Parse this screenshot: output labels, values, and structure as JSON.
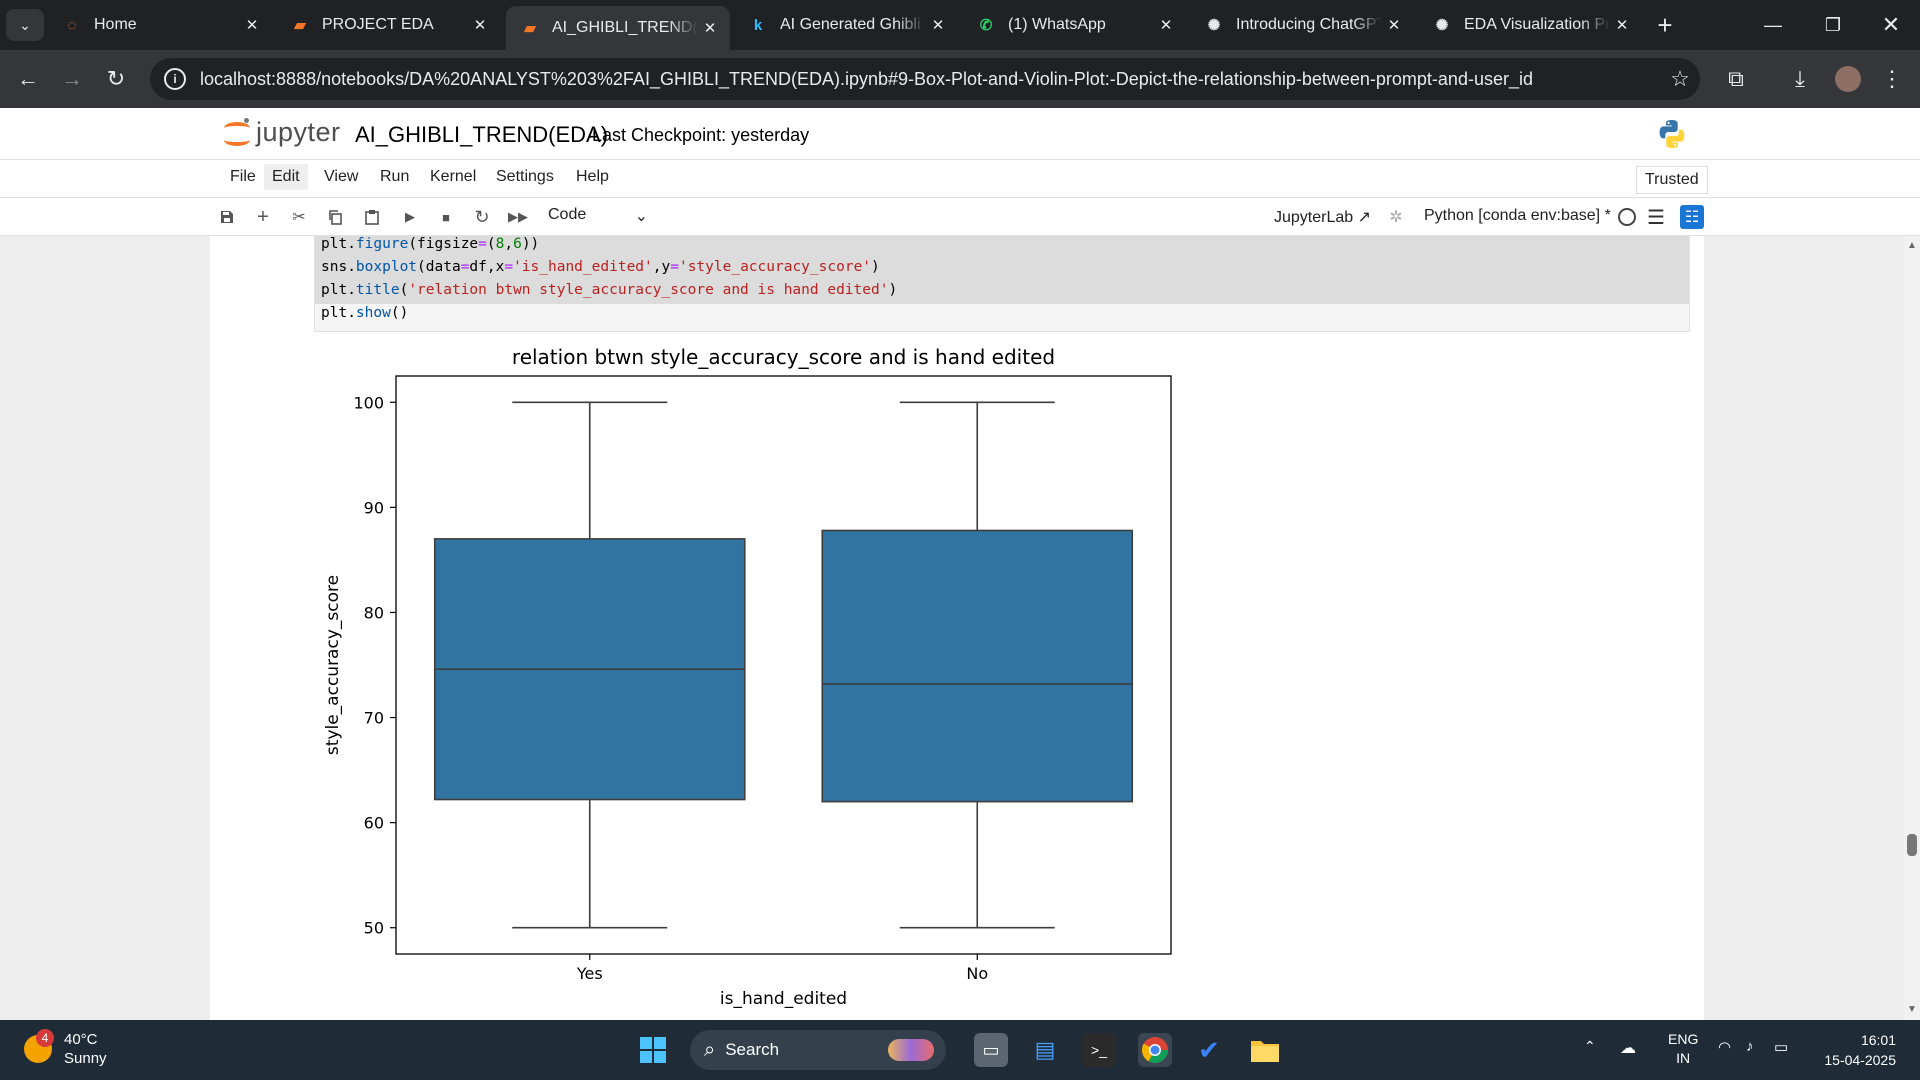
{
  "browser": {
    "tabs": [
      {
        "title": "Home",
        "icon": "jupyter-icon",
        "active": false
      },
      {
        "title": "PROJECT EDA",
        "icon": "notebook-icon",
        "active": false
      },
      {
        "title": "AI_GHIBLI_TREND(EDA",
        "icon": "notebook-icon",
        "active": true
      },
      {
        "title": "AI Generated Ghibli S",
        "icon": "kaggle-icon",
        "active": false
      },
      {
        "title": "(1) WhatsApp",
        "icon": "whatsapp-icon",
        "active": false
      },
      {
        "title": "Introducing ChatGPT",
        "icon": "openai-icon",
        "active": false
      },
      {
        "title": "EDA Visualization Pra",
        "icon": "openai-icon",
        "active": false
      }
    ],
    "url": "localhost:8888/notebooks/DA%20ANALYST%203%2FAI_GHIBLI_TREND(EDA).ipynb#9-Box-Plot-and-Violin-Plot:-Depict-the-relationship-between-prompt-and-user_id"
  },
  "jupyter": {
    "logo_text": "jupyter",
    "notebook_title": "AI_GHIBLI_TREND(EDA)",
    "checkpoint": "Last Checkpoint: yesterday",
    "menu": [
      "File",
      "Edit",
      "View",
      "Run",
      "Kernel",
      "Settings",
      "Help"
    ],
    "highlighted_menu": "Edit",
    "trusted_label": "Trusted",
    "cell_type": "Code",
    "jupyterlab_label": "JupyterLab",
    "kernel_label": "Python [conda env:base] *"
  },
  "code": [
    [
      {
        "t": "plt.",
        "c": "#000"
      },
      {
        "t": "figure",
        "c": "#0055aa"
      },
      {
        "t": "(figsize",
        "c": "#000"
      },
      {
        "t": "=",
        "c": "#aa22ff"
      },
      {
        "t": "(",
        "c": "#000"
      },
      {
        "t": "8",
        "c": "#008000"
      },
      {
        "t": ",",
        "c": "#000"
      },
      {
        "t": "6",
        "c": "#008000"
      },
      {
        "t": "))",
        "c": "#000"
      }
    ],
    [
      {
        "t": "sns.",
        "c": "#000"
      },
      {
        "t": "boxplot",
        "c": "#0055aa"
      },
      {
        "t": "(data",
        "c": "#000"
      },
      {
        "t": "=",
        "c": "#aa22ff"
      },
      {
        "t": "df,x",
        "c": "#000"
      },
      {
        "t": "=",
        "c": "#aa22ff"
      },
      {
        "t": "'is_hand_edited'",
        "c": "#ba2121"
      },
      {
        "t": ",y",
        "c": "#000"
      },
      {
        "t": "=",
        "c": "#aa22ff"
      },
      {
        "t": "'style_accuracy_score'",
        "c": "#ba2121"
      },
      {
        "t": ")",
        "c": "#000"
      }
    ],
    [
      {
        "t": "plt.",
        "c": "#000"
      },
      {
        "t": "title",
        "c": "#0055aa"
      },
      {
        "t": "(",
        "c": "#000"
      },
      {
        "t": "'relation btwn style_accuracy_score and is hand edited'",
        "c": "#ba2121"
      },
      {
        "t": ")",
        "c": "#000"
      }
    ],
    [
      {
        "t": "plt.",
        "c": "#000"
      },
      {
        "t": "show",
        "c": "#0055aa"
      },
      {
        "t": "()",
        "c": "#000"
      }
    ]
  ],
  "chart_data": {
    "type": "box",
    "title": "relation btwn style_accuracy_score and is hand edited",
    "xlabel": "is_hand_edited",
    "ylabel": "style_accuracy_score",
    "categories": [
      "Yes",
      "No"
    ],
    "boxes": [
      {
        "category": "Yes",
        "min": 50,
        "q1": 62.2,
        "median": 74.6,
        "q3": 87.0,
        "max": 100
      },
      {
        "category": "No",
        "min": 50,
        "q1": 62.0,
        "median": 73.2,
        "q3": 87.8,
        "max": 100
      }
    ],
    "ylim": [
      47.5,
      102.5
    ],
    "yticks": [
      50,
      60,
      70,
      80,
      90,
      100
    ],
    "box_color": "#3274a1",
    "grid": false
  },
  "taskbar": {
    "notification_count": "4",
    "temperature": "40°C",
    "weather": "Sunny",
    "search_placeholder": "Search",
    "lang_top": "ENG",
    "lang_bottom": "IN",
    "time": "16:01",
    "date": "15-04-2025"
  }
}
